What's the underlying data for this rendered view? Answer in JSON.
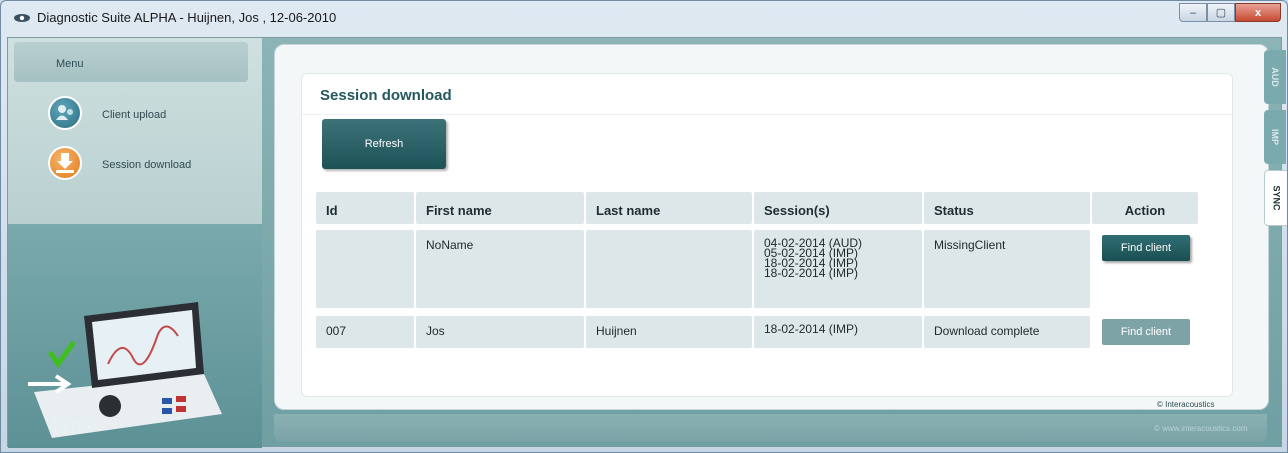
{
  "window": {
    "title": "Diagnostic Suite ALPHA - Huijnen, Jos , 12-06-2010",
    "controls": {
      "minimize": "–",
      "maximize": "▢",
      "close": "x"
    }
  },
  "sidebar": {
    "menu_label": "Menu",
    "items": [
      {
        "label": "Client upload",
        "icon": "client-upload-icon"
      },
      {
        "label": "Session download",
        "icon": "session-download-icon"
      }
    ],
    "device_label": "Sync"
  },
  "main": {
    "title": "Session download",
    "refresh_label": "Refresh",
    "table": {
      "columns": [
        "Id",
        "First name",
        "Last name",
        "Session(s)",
        "Status",
        "Action"
      ],
      "rows": [
        {
          "id": "",
          "first_name": "NoName",
          "last_name": "",
          "sessions": [
            "04-02-2014 (AUD)",
            "05-02-2014 (IMP)",
            "18-02-2014 (IMP)",
            "18-02-2014 (IMP)"
          ],
          "status": "MissingClient",
          "action": "Find client",
          "action_enabled": true
        },
        {
          "id": "007",
          "first_name": "Jos",
          "last_name": "Huijnen",
          "sessions": [
            "18-02-2014 (IMP)"
          ],
          "status": "Download complete",
          "action": "Find client",
          "action_enabled": false
        }
      ]
    }
  },
  "side_tabs": [
    {
      "label": "AUD",
      "active": false
    },
    {
      "label": "IMP",
      "active": false
    },
    {
      "label": "SYNC",
      "active": true
    }
  ],
  "footer": {
    "brand": "© Interacoustics",
    "sub": "© www.interacoustics.com"
  },
  "colors": {
    "accent": "#1d5257",
    "panel": "#dde7e9",
    "background": "#7aa9ad"
  }
}
